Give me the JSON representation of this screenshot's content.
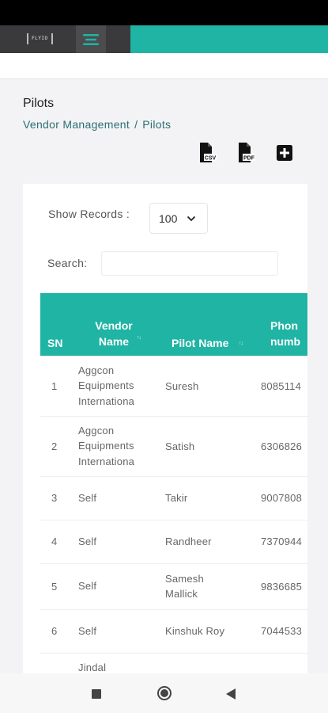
{
  "app": {
    "logo_text": "FLYIO"
  },
  "page": {
    "title": "Pilots"
  },
  "breadcrumb": {
    "parent": "Vendor Management",
    "separator": "/",
    "current": "Pilots"
  },
  "toolbar": {
    "csv_label": "CSV",
    "pdf_label": "PDF",
    "add_icon": "plus-square-icon"
  },
  "records": {
    "label": "Show Records :",
    "selected": "100"
  },
  "search": {
    "label": "Search:",
    "value": "",
    "placeholder": ""
  },
  "table": {
    "headers": {
      "sn": "SN",
      "vendor_line1": "Vendor",
      "vendor_line2": "Name",
      "pilot": "Pilot Name",
      "phone_line1": "Phon",
      "phone_line2": "numb"
    },
    "rows": [
      {
        "sn": "1",
        "vendor": [
          "Aggcon",
          "Equipments",
          "Internationa"
        ],
        "pilot": [
          "Suresh"
        ],
        "phone": "8085114"
      },
      {
        "sn": "2",
        "vendor": [
          "Aggcon",
          "Equipments",
          "Internationa"
        ],
        "pilot": [
          "Satish"
        ],
        "phone": "6306826"
      },
      {
        "sn": "3",
        "vendor": [
          "Self"
        ],
        "pilot": [
          "Takir"
        ],
        "phone": "9007808"
      },
      {
        "sn": "4",
        "vendor": [
          "Self"
        ],
        "pilot": [
          "Randheer"
        ],
        "phone": "7370944"
      },
      {
        "sn": "5",
        "vendor": [
          "Self"
        ],
        "pilot": [
          "Samesh",
          "Mallick"
        ],
        "phone": "9836685"
      },
      {
        "sn": "6",
        "vendor": [
          "Self"
        ],
        "pilot": [
          "Kinshuk Roy"
        ],
        "phone": "7044533"
      },
      {
        "sn": "",
        "vendor": [
          "Jindal"
        ],
        "pilot": [
          ""
        ],
        "phone": ""
      }
    ]
  },
  "colors": {
    "accent": "#1fb4a4",
    "appbar_dark": "#3a3a3c",
    "breadcrumb": "#2a6f73"
  }
}
